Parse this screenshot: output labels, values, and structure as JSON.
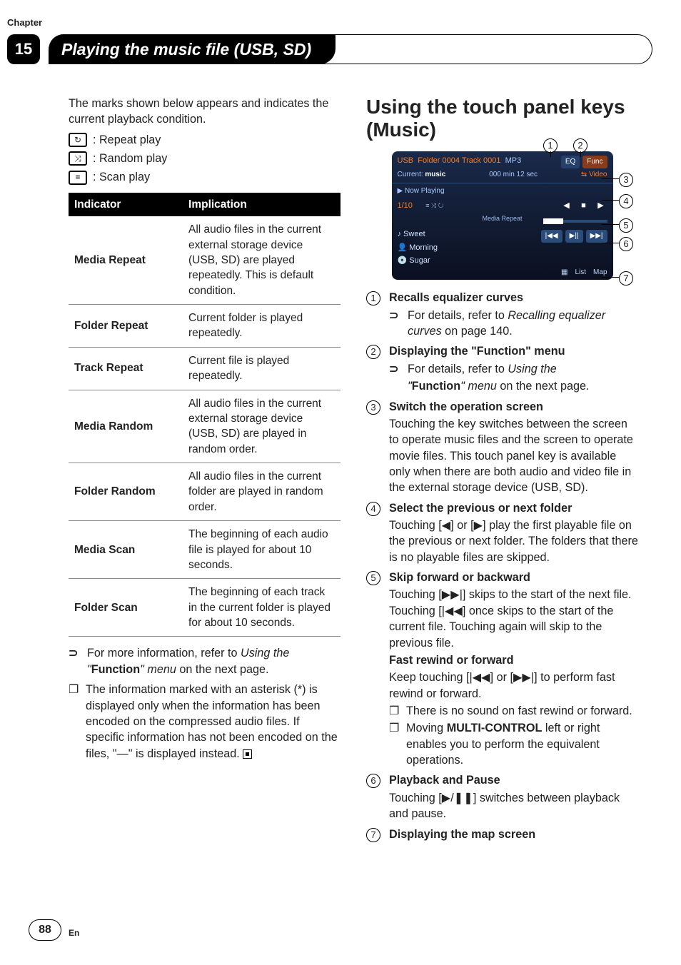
{
  "chapter": {
    "label": "Chapter",
    "number": "15",
    "title": "Playing the music file (USB, SD)"
  },
  "page": {
    "number": "88",
    "lang": "En"
  },
  "left": {
    "intro": "The marks shown below appears and indicates the current playback condition.",
    "icons": {
      "repeat": ": Repeat play",
      "random": ": Random play",
      "scan": ": Scan play"
    },
    "table": {
      "head": {
        "c1": "Indicator",
        "c2": "Implication"
      },
      "rows": [
        {
          "k": "Media Repeat",
          "v": "All audio files in the current external storage device (USB, SD) are played repeatedly. This is default condition."
        },
        {
          "k": "Folder Repeat",
          "v": "Current folder is played repeatedly."
        },
        {
          "k": "Track Repeat",
          "v": "Current file is played repeatedly."
        },
        {
          "k": "Media Random",
          "v": "All audio files in the current external storage device (USB, SD) are played in random order."
        },
        {
          "k": "Folder Random",
          "v": "All audio files in the current folder are played in random order."
        },
        {
          "k": "Media Scan",
          "v": "The beginning of each audio file is played for about 10 seconds."
        },
        {
          "k": "Folder Scan",
          "v": "The beginning of each track in the current folder is played for about 10 seconds."
        }
      ]
    },
    "more_pre": "For more information, refer to ",
    "more_link1": "Using the",
    "more_q1": "\"",
    "more_func": "Function",
    "more_q2": "\"",
    "more_link2": " menu",
    "more_tail": " on the next page.",
    "asterisk": "The information marked with an asterisk (*) is displayed only when the information has been encoded on the compressed audio files. If specific information has not been encoded on the files, \"—\" is displayed instead."
  },
  "right": {
    "heading": "Using the touch panel keys (Music)",
    "screenshot": {
      "usb": "USB",
      "folder_track": "Folder 0004   Track 0001",
      "mp3": "MP3",
      "eq": "EQ",
      "func": "Func",
      "current_label": "Current:",
      "current_val": "music",
      "time": "000 min 12 sec",
      "switch": "⇆ Video",
      "now_playing": "▶  Now Playing",
      "count": "1/10",
      "media_repeat": "Media Repeat",
      "t1": "♪ Sweet",
      "t2": "👤 Morning",
      "t3": "💿 Sugar",
      "list": "List",
      "map": "Map"
    },
    "features": [
      {
        "n": "1",
        "title": "Recalls equalizer curves",
        "subs": [
          {
            "type": "arrow",
            "pre": "For details, refer to ",
            "it": "Recalling equalizer curves",
            "post": " on page 140."
          }
        ]
      },
      {
        "n": "2",
        "title": "Displaying the \"Function\" menu",
        "subs": [
          {
            "type": "arrow",
            "pre": "For details, refer to ",
            "it": "Using the",
            "post": ""
          },
          {
            "type": "funcline",
            "q1": "\"",
            "func": "Function",
            "q2": "\"",
            "it": " menu",
            "post": " on the next page."
          }
        ]
      },
      {
        "n": "3",
        "title": "Switch the operation screen",
        "paras": [
          "Touching the key switches between the screen to operate music files and the screen to operate movie files. This touch panel key is available only when there are both audio and video file in the external storage device (USB, SD)."
        ]
      },
      {
        "n": "4",
        "title": "Select the previous or next folder",
        "paras": [
          "Touching [◀] or [▶] play the first playable file on the previous or next folder. The folders that there is no playable files are skipped."
        ]
      },
      {
        "n": "5",
        "title": "Skip forward or backward",
        "paras": [
          "Touching [▶▶|] skips to the start of the next file. Touching [|◀◀] once skips to the start of the current file. Touching again will skip to the previous file."
        ],
        "sub_title": "Fast rewind or forward",
        "paras2": [
          "Keep touching [|◀◀] or [▶▶|] to perform fast rewind or forward."
        ],
        "bullets": [
          "There is no sound on fast rewind or forward.",
          {
            "pre": "Moving ",
            "b": "MULTI-CONTROL",
            "post": " left or right enables you to perform the equivalent operations."
          }
        ]
      },
      {
        "n": "6",
        "title": "Playback and Pause",
        "paras": [
          "Touching [▶/❚❚] switches between playback and pause."
        ]
      },
      {
        "n": "7",
        "title": "Displaying the map screen"
      }
    ]
  }
}
